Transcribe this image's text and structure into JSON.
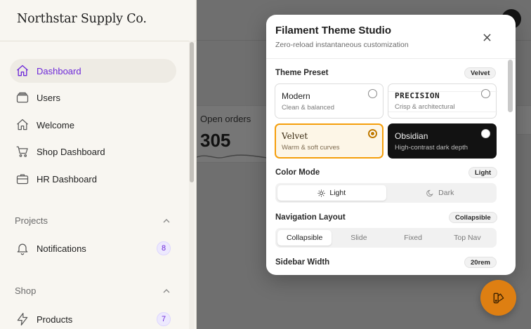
{
  "sidebar": {
    "brand": "Northstar Supply Co.",
    "items": [
      {
        "label": "Dashboard",
        "icon": "home-icon",
        "active": true
      },
      {
        "label": "Users",
        "icon": "stack-icon"
      },
      {
        "label": "Welcome",
        "icon": "home-icon"
      },
      {
        "label": "Shop Dashboard",
        "icon": "cart-icon"
      },
      {
        "label": "HR Dashboard",
        "icon": "briefcase-icon"
      }
    ],
    "groups": [
      {
        "label": "Projects",
        "items": [
          {
            "label": "Notifications",
            "icon": "bell-icon",
            "badge": "8"
          }
        ]
      },
      {
        "label": "Shop",
        "items": [
          {
            "label": "Products",
            "icon": "bolt-icon",
            "badge": "7"
          }
        ]
      }
    ]
  },
  "main": {
    "stat": {
      "label": "Open orders",
      "value": "305"
    }
  },
  "modal": {
    "title": "Filament Theme Studio",
    "subtitle": "Zero-reload instantaneous customization",
    "theme_preset": {
      "label": "Theme Preset",
      "current": "Velvet",
      "options": [
        {
          "name": "Modern",
          "desc": "Clean & balanced"
        },
        {
          "name": "PRECISION",
          "desc": "Crisp & architectural"
        },
        {
          "name": "Velvet",
          "desc": "Warm & soft curves",
          "selected": true
        },
        {
          "name": "Obsidian",
          "desc": "High-contrast dark depth"
        }
      ]
    },
    "color_mode": {
      "label": "Color Mode",
      "current": "Light",
      "options": [
        "Light",
        "Dark"
      ]
    },
    "navigation_layout": {
      "label": "Navigation Layout",
      "current": "Collapsible",
      "options": [
        "Collapsible",
        "Slide",
        "Fixed",
        "Top Nav"
      ]
    },
    "sidebar_width": {
      "label": "Sidebar Width",
      "current": "20rem"
    }
  },
  "colors": {
    "accent_purple": "#6d28d9",
    "velvet_amber": "#f59e0b",
    "fab_orange": "#de7f12"
  }
}
